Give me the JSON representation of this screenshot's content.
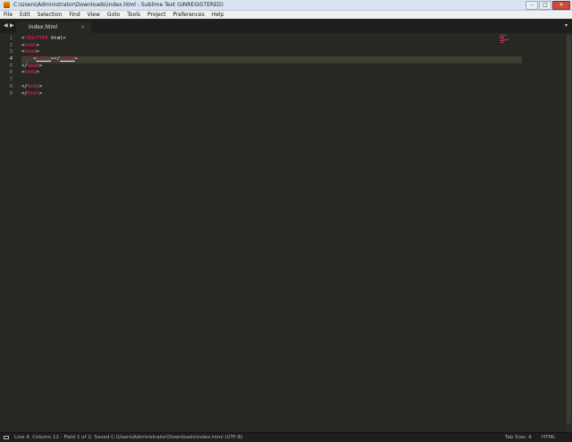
{
  "window": {
    "title": "C:\\Users\\Administrator\\Downloads\\index.html - Sublime Text (UNREGISTERED)",
    "minimize": "–",
    "maximize": "□",
    "close": "✕"
  },
  "menu": [
    "File",
    "Edit",
    "Selection",
    "Find",
    "View",
    "Goto",
    "Tools",
    "Project",
    "Preferences",
    "Help"
  ],
  "tabs": {
    "prev": "◀",
    "next": "▶",
    "active_tab": "index.html",
    "close": "×",
    "menu": "▾"
  },
  "editor": {
    "line_numbers": [
      "1",
      "2",
      "3",
      "4",
      "5",
      "6",
      "7",
      "8",
      "9"
    ],
    "active_line": 4
  },
  "status": {
    "text": "Line 4, Column 12 - Field 1 of 2; Saved C:\\Users\\Administrator\\Downloads\\index.html (UTF-8)",
    "tab_size": "Tab Size: 4",
    "syntax": "HTML"
  },
  "colors": {
    "background": "#272822",
    "tag": "#f92672",
    "text": "#f8f8f2",
    "gutter": "#8f908a"
  }
}
